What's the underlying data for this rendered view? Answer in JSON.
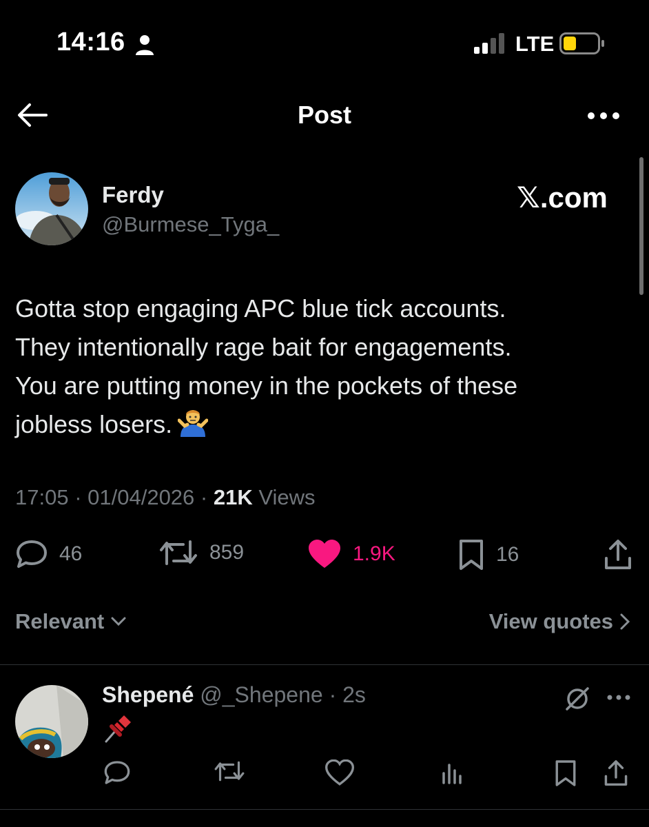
{
  "status_bar": {
    "time": "14:16",
    "network": "LTE"
  },
  "header": {
    "title": "Post"
  },
  "post": {
    "author_name": "Ferdy",
    "author_handle": "@Burmese_Tyga_",
    "watermark": "𝕏.com",
    "text": "Gotta stop engaging APC blue tick accounts.\nThey intentionally rage bait for engagements.\nYou are putting money in the pockets of these\njobless losers.",
    "time": "17:05",
    "date": "01/04/2026",
    "views_count": "21K",
    "views_label": "Views",
    "replies": "46",
    "reposts": "859",
    "likes": "1.9K",
    "bookmarks": "16"
  },
  "sort": {
    "label": "Relevant",
    "quotes_label": "View quotes"
  },
  "reply": {
    "name": "Shepené",
    "handle": "@_Shepene",
    "time": "2s"
  },
  "colors": {
    "background": "#000000",
    "like": "#f91880",
    "muted": "#71767b",
    "text": "#e7e9ea",
    "battery": "#ffd60a"
  },
  "icons": [
    "person-icon",
    "signal-icon",
    "battery-icon",
    "back-arrow-icon",
    "more-icon",
    "reply-icon",
    "repost-icon",
    "heart-icon",
    "bookmark-icon",
    "share-icon",
    "chevron-down-icon",
    "chevron-right-icon",
    "mute-icon",
    "views-icon",
    "pin-emoji",
    "shrug-emoji"
  ]
}
